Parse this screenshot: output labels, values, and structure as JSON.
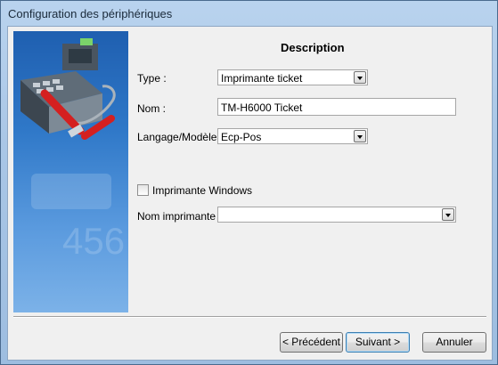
{
  "window": {
    "title": "Configuration des périphériques"
  },
  "form": {
    "heading": "Description",
    "type_label": "Type :",
    "type_value": "Imprimante ticket",
    "name_label": "Nom :",
    "name_value": "TM-H6000 Ticket",
    "lang_label": "Langage/Modèle :",
    "lang_value": "Ecp-Pos",
    "windows_printer_label": "Imprimante Windows",
    "windows_printer_checked": false,
    "printer_name_label": "Nom imprimante :",
    "printer_name_value": ""
  },
  "buttons": {
    "prev": "< Précédent",
    "next": "Suivant >",
    "cancel": "Annuler"
  }
}
